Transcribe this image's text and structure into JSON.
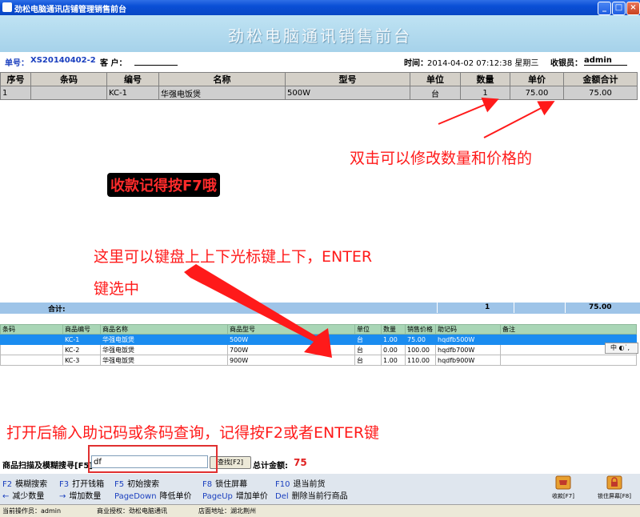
{
  "window": {
    "title": "劲松电脑通讯店铺管理销售前台",
    "min": "_",
    "max": "□",
    "close": "×"
  },
  "header": {
    "title": "劲松电脑通讯销售前台"
  },
  "info": {
    "order_label": "单号：",
    "order_no": "XS20140402-2",
    "customer_label": "客 户：",
    "customer_value": "",
    "time_label": "时间：",
    "time_value": "2014-04-02 07:12:38 星期三",
    "cashier_label": "收银员：",
    "cashier_value": "admin"
  },
  "sale_table": {
    "columns": [
      "序号",
      "条码",
      "编号",
      "名称",
      "型号",
      "单位",
      "数量",
      "单价",
      "金额合计"
    ],
    "rows": [
      [
        "1",
        "",
        "KC-1",
        "华强电饭煲",
        "500W",
        "台",
        "1",
        "75.00",
        "75.00"
      ]
    ]
  },
  "totals": {
    "label": "合计:",
    "qty": "1",
    "amount": "75.00"
  },
  "product_table": {
    "columns": [
      "条码",
      "商品编号",
      "商品名称",
      "商品型号",
      "单位",
      "数量",
      "销售价格",
      "助记码",
      "备注"
    ],
    "rows": [
      [
        "",
        "KC-1",
        "华强电饭煲",
        "500W",
        "台",
        "1.00",
        "75.00",
        "hqdfb500W",
        ""
      ],
      [
        "",
        "KC-2",
        "华强电饭煲",
        "700W",
        "台",
        "0.00",
        "100.00",
        "hqdfb700W",
        ""
      ],
      [
        "",
        "KC-3",
        "华强电饭煲",
        "900W",
        "台",
        "1.00",
        "110.00",
        "hqdfb900W",
        ""
      ]
    ]
  },
  "ime": {
    "label": "中"
  },
  "search": {
    "label": "商品扫描及模糊搜寻[F5]",
    "value": "df",
    "button": "查找[F2]",
    "total_label": "总计金额:",
    "total_value": "75"
  },
  "hotkeys": [
    {
      "key": "F2",
      "label": "模糊搜索"
    },
    {
      "key": "F3",
      "label": "打开钱箱"
    },
    {
      "key": "F5",
      "label": "初始搜索"
    },
    {
      "key": "F8",
      "label": "锁住屏幕"
    },
    {
      "key": "F10",
      "label": "退当前货"
    },
    {
      "key": "←",
      "label": "减少数量"
    },
    {
      "key": "→",
      "label": "增加数量"
    },
    {
      "key": "PageDown",
      "label": "降低单价"
    },
    {
      "key": "PageUp",
      "label": "增加单价"
    },
    {
      "key": "Del",
      "label": "删除当前行商品"
    }
  ],
  "actions": {
    "checkout": "收款[F7]",
    "lock": "锁住屏幕[F8]"
  },
  "statusbar": {
    "operator": "当前操作员：admin",
    "license": "商业授权：劲松电脑通讯",
    "address": "店面地址：湖北荆州"
  },
  "annotations": {
    "edit_hint": "双击可以修改数量和价格的",
    "checkout_hint": "收款记得按F7哦",
    "nav_hint_1": "这里可以键盘上上下光标键上下，ENTER",
    "nav_hint_2": "键选中",
    "search_hint": "打开后输入助记码或条码查询，记得按F2或者ENTER键"
  },
  "colors": {
    "accent_red": "#ff1a1a",
    "selected_row": "#1a8cf0",
    "header_bg": "#a6d2ea"
  }
}
